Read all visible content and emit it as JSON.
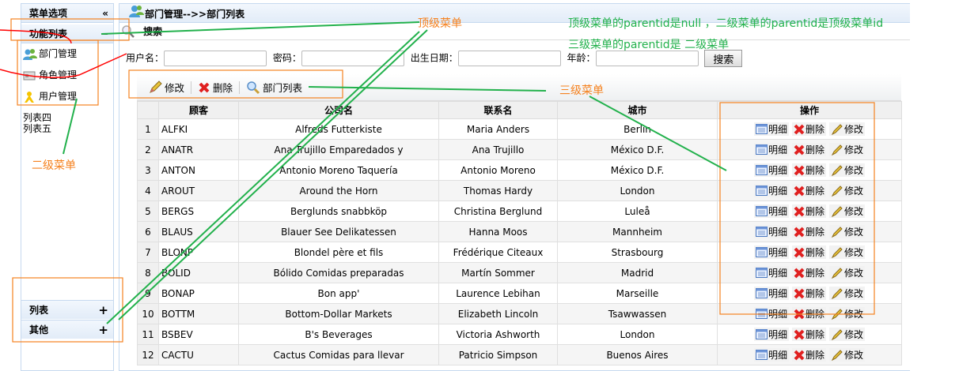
{
  "sidebar": {
    "header": "菜单选项",
    "collapse_icon": "«",
    "section": "功能列表",
    "section_toggle": "−",
    "items": [
      {
        "label": "部门管理",
        "icon": "users-icon"
      },
      {
        "label": "角色管理",
        "icon": "card-icon"
      },
      {
        "label": "用户管理",
        "icon": "user-icon"
      }
    ],
    "plain_items": [
      "列表四",
      "列表五"
    ],
    "bottom": [
      {
        "label": "列表",
        "toggle": "+"
      },
      {
        "label": "其他",
        "toggle": "+"
      }
    ]
  },
  "main": {
    "title": "部门管理-->>部门列表",
    "search_title": "搜索",
    "form": {
      "username": "用户名：",
      "password": "密码：",
      "birthdate": "出生日期：",
      "age": "年龄：",
      "search_button": "搜索"
    },
    "toolbar": [
      "修改",
      "删除",
      "部门列表"
    ]
  },
  "table": {
    "headers": [
      "",
      "顾客",
      "公司名",
      "联系名",
      "城市",
      "操作"
    ],
    "ops": [
      "明细",
      "删除",
      "修改"
    ],
    "rows": [
      [
        "1",
        "ALFKI",
        "Alfreds Futterkiste",
        "Maria Anders",
        "Berlin"
      ],
      [
        "2",
        "ANATR",
        "Ana Trujillo Emparedados y",
        "Ana Trujillo",
        "México D.F."
      ],
      [
        "3",
        "ANTON",
        "Antonio Moreno Taquería",
        "Antonio Moreno",
        "México D.F."
      ],
      [
        "4",
        "AROUT",
        "Around the Horn",
        "Thomas Hardy",
        "London"
      ],
      [
        "5",
        "BERGS",
        "Berglunds snabbköp",
        "Christina Berglund",
        "Luleå"
      ],
      [
        "6",
        "BLAUS",
        "Blauer See Delikatessen",
        "Hanna Moos",
        "Mannheim"
      ],
      [
        "7",
        "BLONP",
        "Blondel père et fils",
        "Frédérique Citeaux",
        "Strasbourg"
      ],
      [
        "8",
        "BOLID",
        "Bólido Comidas preparadas",
        "Martín Sommer",
        "Madrid"
      ],
      [
        "9",
        "BONAP",
        "Bon app'",
        "Laurence Lebihan",
        "Marseille"
      ],
      [
        "10",
        "BOTTM",
        "Bottom-Dollar Markets",
        "Elizabeth Lincoln",
        "Tsawwassen"
      ],
      [
        "11",
        "BSBEV",
        "B's Beverages",
        "Victoria Ashworth",
        "London"
      ],
      [
        "12",
        "CACTU",
        "Cactus Comidas para llevar",
        "Patricio Simpson",
        "Buenos Aires"
      ]
    ]
  },
  "annotations": {
    "top_menu": "顶级菜单",
    "second_menu": "二级菜单",
    "third_menu": "三级菜单",
    "note1": "顶级菜单的parentid是null  ，二级菜单的parentid是顶级菜单id",
    "note2": "三级菜单的parentid是 二级菜单",
    "orange": "#f58220",
    "green": "#22b14c",
    "red": "#ff0000"
  }
}
